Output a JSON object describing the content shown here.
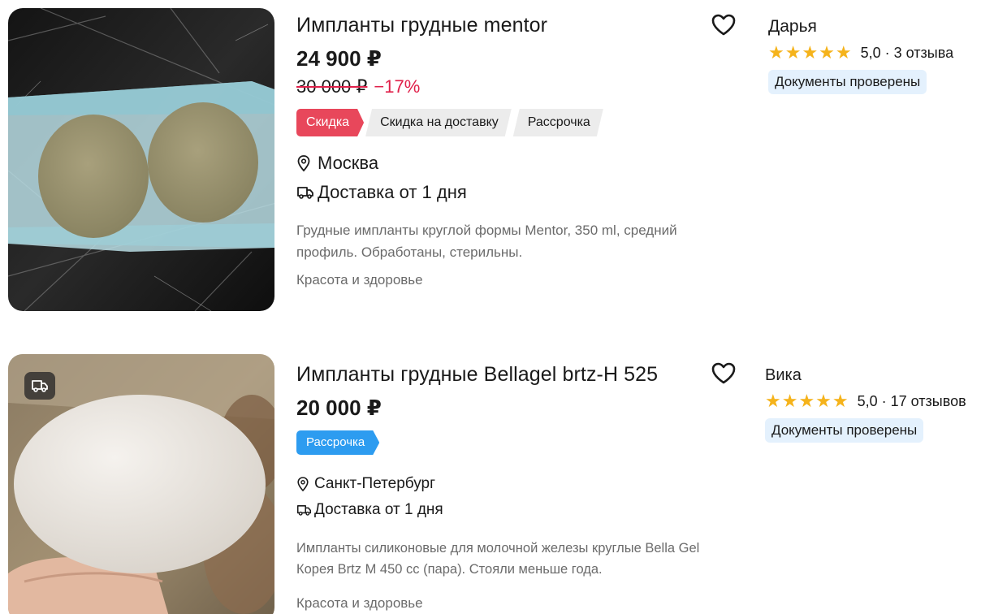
{
  "listings": [
    {
      "title": "Импланты грудные mentor",
      "price": "24 900 ₽",
      "old_price": "30 000 ₽",
      "discount": "−17%",
      "tags": [
        "Скидка",
        "Скидка на доставку",
        "Рассрочка"
      ],
      "location": "Москва",
      "delivery": "Доставка от 1 дня",
      "description_line1": "Грудные импланты круглой формы Mentor, 350 ml, средний",
      "description_line2": "профиль. Обработаны, стерильны.",
      "category": "Красота и здоровье",
      "seller": {
        "name": "Дарья",
        "stars": "★★★★★",
        "rating": "5,0 · 3 отзыва",
        "docs_badge": "Документы проверены"
      }
    },
    {
      "title": "Импланты грудные Bellagel brtz-H 525",
      "price": "20 000 ₽",
      "tags": [
        "Рассрочка"
      ],
      "location": "Санкт-Петербург",
      "delivery": "Доставка от 1 дня",
      "description_line1": "Импланты силиконовые для молочной железы круглые Bella Gel",
      "description_line2": "Корея Brtz M 450 cc (пара). Стояли меньше года.",
      "category": "Красота и здоровье",
      "seller": {
        "name": "Вика",
        "stars": "★★★★★",
        "rating": "5,0 · 17 отзывов",
        "docs_badge": "Документы проверены"
      }
    }
  ],
  "icons": {
    "favorite": "heart-icon",
    "location": "location-pin-icon",
    "delivery": "delivery-truck-icon"
  },
  "colors": {
    "discount_red": "#e0204a",
    "tag_red": "#e8475b",
    "tag_blue": "#2d9cf0",
    "star": "#f5b31b",
    "docs_bg": "#e4f1fd"
  }
}
